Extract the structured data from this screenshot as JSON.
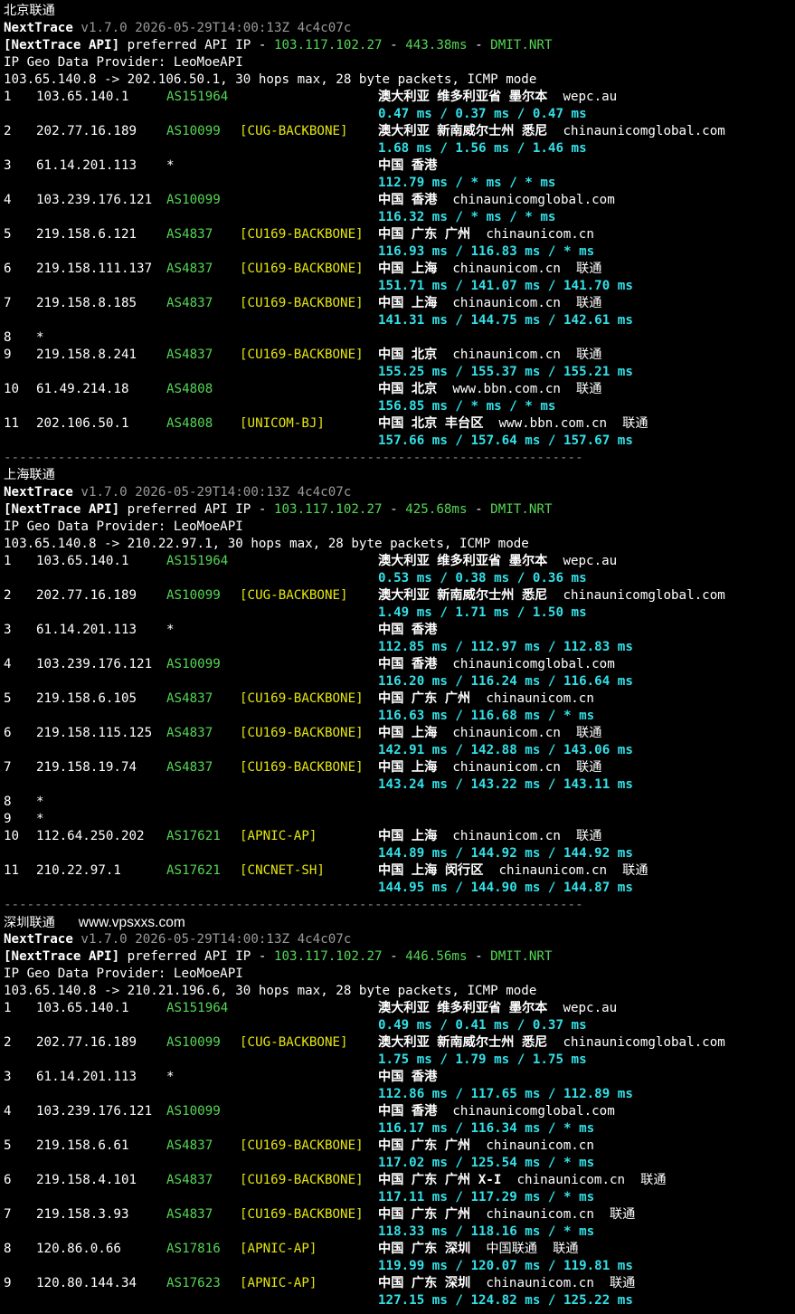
{
  "colors": {
    "background": "#000000",
    "as_number": "#55d655",
    "backbone": "#e5e510",
    "latency": "#33e0e8",
    "api_ip": "#55d655"
  },
  "separator": "---------------------------------------------------------------------------",
  "blocks": [
    {
      "title": "北京联通",
      "watermark": "",
      "tool_name": "NextTrace",
      "version": "v1.7.0 2026-05-29T14:00:13Z 4c4c07c",
      "api_prefix": "[NextTrace API]",
      "api_text": "preferred API IP -",
      "api_ip": "103.117.102.27",
      "api_latency": "443.38ms",
      "api_dash": "-",
      "api_node": "DMIT.NRT",
      "geo_provider": "IP Geo Data Provider: LeoMoeAPI",
      "route": "103.65.140.8 -> 202.106.50.1, 30 hops max, 28 byte packets, ICMP mode",
      "hops": [
        {
          "n": "1",
          "ip": "103.65.140.1",
          "as": "AS151964",
          "tag": "",
          "geo": "澳大利亚 维多利亚省 墨尔本",
          "host": "wepc.au",
          "rtt": "0.47 ms / 0.37 ms / 0.47 ms"
        },
        {
          "n": "2",
          "ip": "202.77.16.189",
          "as": "AS10099",
          "tag": "[CUG-BACKBONE]",
          "geo": "澳大利亚 新南威尔士州 悉尼",
          "host": "chinaunicomglobal.com",
          "rtt": "1.68 ms / 1.56 ms / 1.46 ms"
        },
        {
          "n": "3",
          "ip": "61.14.201.113",
          "as": "*",
          "tag": "",
          "geo": "中国 香港",
          "host": "",
          "rtt": "112.79 ms / * ms / * ms"
        },
        {
          "n": "4",
          "ip": "103.239.176.121",
          "as": "AS10099",
          "tag": "",
          "geo": "中国 香港",
          "host": "chinaunicomglobal.com",
          "rtt": "116.32 ms / * ms / * ms"
        },
        {
          "n": "5",
          "ip": "219.158.6.121",
          "as": "AS4837",
          "tag": "[CU169-BACKBONE]",
          "geo": "中国 广东 广州",
          "host": "chinaunicom.cn",
          "rtt": "116.93 ms / 116.83 ms / * ms"
        },
        {
          "n": "6",
          "ip": "219.158.111.137",
          "as": "AS4837",
          "tag": "[CU169-BACKBONE]",
          "geo": "中国 上海",
          "host": "chinaunicom.cn  联通",
          "rtt": "151.71 ms / 141.07 ms / 141.70 ms"
        },
        {
          "n": "7",
          "ip": "219.158.8.185",
          "as": "AS4837",
          "tag": "[CU169-BACKBONE]",
          "geo": "中国 上海",
          "host": "chinaunicom.cn  联通",
          "rtt": "141.31 ms / 144.75 ms / 142.61 ms"
        },
        {
          "n": "8",
          "ip": "*",
          "as": "",
          "tag": "",
          "geo": "",
          "host": "",
          "rtt": ""
        },
        {
          "n": "9",
          "ip": "219.158.8.241",
          "as": "AS4837",
          "tag": "[CU169-BACKBONE]",
          "geo": "中国 北京",
          "host": "chinaunicom.cn  联通",
          "rtt": "155.25 ms / 155.37 ms / 155.21 ms"
        },
        {
          "n": "10",
          "ip": "61.49.214.18",
          "as": "AS4808",
          "tag": "",
          "geo": "中国 北京",
          "host": "www.bbn.com.cn  联通",
          "rtt": "156.85 ms / * ms / * ms"
        },
        {
          "n": "11",
          "ip": "202.106.50.1",
          "as": "AS4808",
          "tag": "[UNICOM-BJ]",
          "geo": "中国 北京 丰台区",
          "host": "www.bbn.com.cn  联通",
          "rtt": "157.66 ms / 157.64 ms / 157.67 ms"
        }
      ]
    },
    {
      "title": "上海联通",
      "watermark": "",
      "tool_name": "NextTrace",
      "version": "v1.7.0 2026-05-29T14:00:13Z 4c4c07c",
      "api_prefix": "[NextTrace API]",
      "api_text": "preferred API IP -",
      "api_ip": "103.117.102.27",
      "api_latency": "425.68ms",
      "api_dash": "-",
      "api_node": "DMIT.NRT",
      "geo_provider": "IP Geo Data Provider: LeoMoeAPI",
      "route": "103.65.140.8 -> 210.22.97.1, 30 hops max, 28 byte packets, ICMP mode",
      "hops": [
        {
          "n": "1",
          "ip": "103.65.140.1",
          "as": "AS151964",
          "tag": "",
          "geo": "澳大利亚 维多利亚省 墨尔本",
          "host": "wepc.au",
          "rtt": "0.53 ms / 0.38 ms / 0.36 ms"
        },
        {
          "n": "2",
          "ip": "202.77.16.189",
          "as": "AS10099",
          "tag": "[CUG-BACKBONE]",
          "geo": "澳大利亚 新南威尔士州 悉尼",
          "host": "chinaunicomglobal.com",
          "rtt": "1.49 ms / 1.71 ms / 1.50 ms"
        },
        {
          "n": "3",
          "ip": "61.14.201.113",
          "as": "*",
          "tag": "",
          "geo": "中国 香港",
          "host": "",
          "rtt": "112.85 ms / 112.97 ms / 112.83 ms"
        },
        {
          "n": "4",
          "ip": "103.239.176.121",
          "as": "AS10099",
          "tag": "",
          "geo": "中国 香港",
          "host": "chinaunicomglobal.com",
          "rtt": "116.20 ms / 116.24 ms / 116.64 ms"
        },
        {
          "n": "5",
          "ip": "219.158.6.105",
          "as": "AS4837",
          "tag": "[CU169-BACKBONE]",
          "geo": "中国 广东 广州",
          "host": "chinaunicom.cn",
          "rtt": "116.63 ms / 116.68 ms / * ms"
        },
        {
          "n": "6",
          "ip": "219.158.115.125",
          "as": "AS4837",
          "tag": "[CU169-BACKBONE]",
          "geo": "中国 上海",
          "host": "chinaunicom.cn  联通",
          "rtt": "142.91 ms / 142.88 ms / 143.06 ms"
        },
        {
          "n": "7",
          "ip": "219.158.19.74",
          "as": "AS4837",
          "tag": "[CU169-BACKBONE]",
          "geo": "中国 上海",
          "host": "chinaunicom.cn  联通",
          "rtt": "143.24 ms / 143.22 ms / 143.11 ms"
        },
        {
          "n": "8",
          "ip": "*",
          "as": "",
          "tag": "",
          "geo": "",
          "host": "",
          "rtt": ""
        },
        {
          "n": "9",
          "ip": "*",
          "as": "",
          "tag": "",
          "geo": "",
          "host": "",
          "rtt": ""
        },
        {
          "n": "10",
          "ip": "112.64.250.202",
          "as": "AS17621",
          "tag": "[APNIC-AP]",
          "geo": "中国 上海",
          "host": "chinaunicom.cn  联通",
          "rtt": "144.89 ms / 144.92 ms / 144.92 ms"
        },
        {
          "n": "11",
          "ip": "210.22.97.1",
          "as": "AS17621",
          "tag": "[CNCNET-SH]",
          "geo": "中国 上海 闵行区",
          "host": "chinaunicom.cn  联通",
          "rtt": "144.95 ms / 144.90 ms / 144.87 ms"
        }
      ]
    },
    {
      "title": "深圳联通",
      "watermark": "www.vpsxxs.com",
      "tool_name": "NextTrace",
      "version": "v1.7.0 2026-05-29T14:00:13Z 4c4c07c",
      "api_prefix": "[NextTrace API]",
      "api_text": "preferred API IP -",
      "api_ip": "103.117.102.27",
      "api_latency": "446.56ms",
      "api_dash": "-",
      "api_node": "DMIT.NRT",
      "geo_provider": "IP Geo Data Provider: LeoMoeAPI",
      "route": "103.65.140.8 -> 210.21.196.6, 30 hops max, 28 byte packets, ICMP mode",
      "hops": [
        {
          "n": "1",
          "ip": "103.65.140.1",
          "as": "AS151964",
          "tag": "",
          "geo": "澳大利亚 维多利亚省 墨尔本",
          "host": "wepc.au",
          "rtt": "0.49 ms / 0.41 ms / 0.37 ms"
        },
        {
          "n": "2",
          "ip": "202.77.16.189",
          "as": "AS10099",
          "tag": "[CUG-BACKBONE]",
          "geo": "澳大利亚 新南威尔士州 悉尼",
          "host": "chinaunicomglobal.com",
          "rtt": "1.75 ms / 1.79 ms / 1.75 ms"
        },
        {
          "n": "3",
          "ip": "61.14.201.113",
          "as": "*",
          "tag": "",
          "geo": "中国 香港",
          "host": "",
          "rtt": "112.86 ms / 117.65 ms / 112.89 ms"
        },
        {
          "n": "4",
          "ip": "103.239.176.121",
          "as": "AS10099",
          "tag": "",
          "geo": "中国 香港",
          "host": "chinaunicomglobal.com",
          "rtt": "116.17 ms / 116.34 ms / * ms"
        },
        {
          "n": "5",
          "ip": "219.158.6.61",
          "as": "AS4837",
          "tag": "[CU169-BACKBONE]",
          "geo": "中国 广东 广州",
          "host": "chinaunicom.cn",
          "rtt": "117.02 ms / 125.54 ms / * ms"
        },
        {
          "n": "6",
          "ip": "219.158.4.101",
          "as": "AS4837",
          "tag": "[CU169-BACKBONE]",
          "geo": "中国 广东 广州 X-I",
          "host": "chinaunicom.cn  联通",
          "rtt": "117.11 ms / 117.29 ms / * ms"
        },
        {
          "n": "7",
          "ip": "219.158.3.93",
          "as": "AS4837",
          "tag": "[CU169-BACKBONE]",
          "geo": "中国 广东 广州",
          "host": "chinaunicom.cn  联通",
          "rtt": "118.33 ms / 118.16 ms / * ms"
        },
        {
          "n": "8",
          "ip": "120.86.0.66",
          "as": "AS17816",
          "tag": "[APNIC-AP]",
          "geo": "中国 广东 深圳",
          "host": "中国联通  联通",
          "rtt": "119.99 ms / 120.07 ms / 119.81 ms"
        },
        {
          "n": "9",
          "ip": "120.80.144.34",
          "as": "AS17623",
          "tag": "[APNIC-AP]",
          "geo": "中国 广东 深圳",
          "host": "chinaunicom.cn  联通",
          "rtt": "127.15 ms / 124.82 ms / 125.22 ms"
        }
      ]
    }
  ]
}
